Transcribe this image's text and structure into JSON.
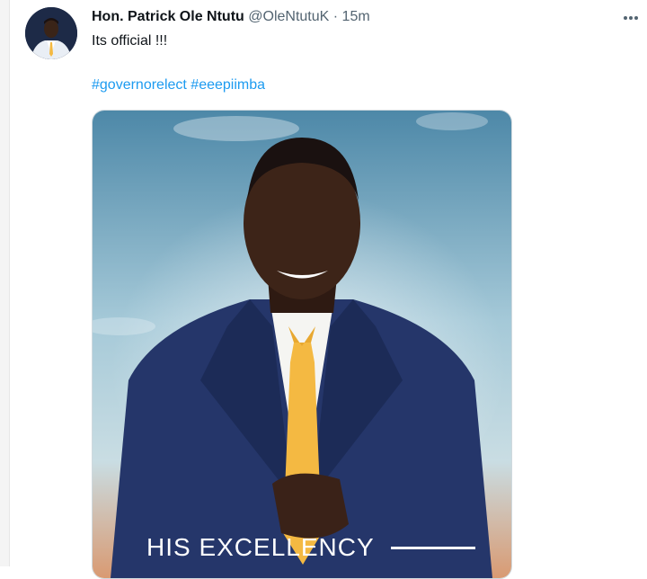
{
  "tweet": {
    "author_name": "Hon. Patrick Ole Ntutu",
    "author_handle": "@OleNtutuK",
    "separator": "·",
    "time": "15m",
    "text": "Its official !!!",
    "hashtags": [
      "#governorelect",
      "#eeepiimba"
    ],
    "more_icon": "more-horizontal-icon",
    "media_caption": "HIS EXCELLENCY"
  },
  "colors": {
    "link": "#1d9bf0",
    "secondary_text": "#536471",
    "suit": "#25366a",
    "tie": "#f4b942"
  }
}
